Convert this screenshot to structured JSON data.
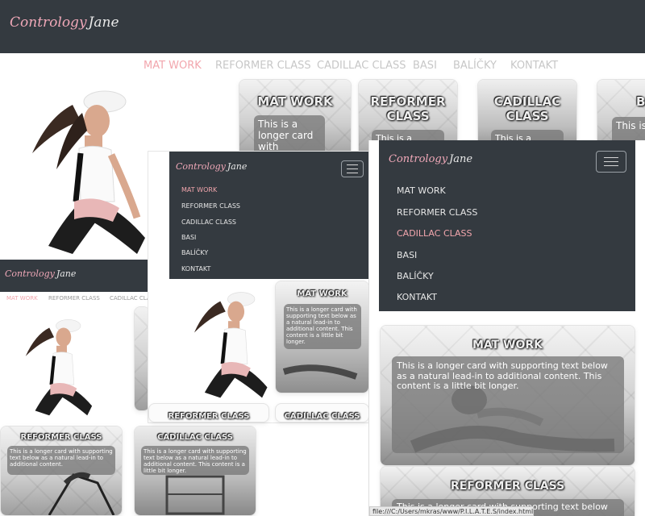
{
  "brand": {
    "logo_text": "Contrology",
    "signature": "Jane"
  },
  "nav": {
    "items": [
      {
        "label": "MAT WORK"
      },
      {
        "label": "REFORMER CLASS"
      },
      {
        "label": "CADILLAC CLASS"
      },
      {
        "label": "BASI"
      },
      {
        "label": "BALÍČKY"
      },
      {
        "label": "KONTAKT"
      }
    ],
    "mid_active_index": 0,
    "large_active_index": 2
  },
  "cards": {
    "mat_work": "MAT WORK",
    "reformer": "REFORMER CLASS",
    "reformer_line1": "REFORMER",
    "reformer_line2": "CLASS",
    "cadillac": "CADILLAC CLASS",
    "cadillac_line1": "CADILLAC",
    "cadillac_line2": "CLASS",
    "ba_partial": "BA",
    "text_short": "This is a longer card with",
    "text_full": "This is a longer card with supporting text below as a natural lead-in to additional content. This content is a little bit longer.",
    "text_mid": "This is a longer card with supporting text below as a natural lead-in to additional content. This content is a little bit longer.",
    "text_small": "This is a longer card with supporting text below as a natural lead-in to additional content.",
    "text_small2": "This is a longer card with supporting text below as a natural lead-in to additional content. This content is a little bit longer.",
    "this_is_a": "This is a",
    "text_bottom": "This is a longer card with supporting text below as a"
  },
  "statusbar": {
    "url": "file:///C:/Users/mkras/www/P.I.L.A.T.E.S/index.html#"
  },
  "colors": {
    "dark": "#343a40",
    "accent": "#f2a6ad",
    "nav_text": "#c7c7c7"
  }
}
